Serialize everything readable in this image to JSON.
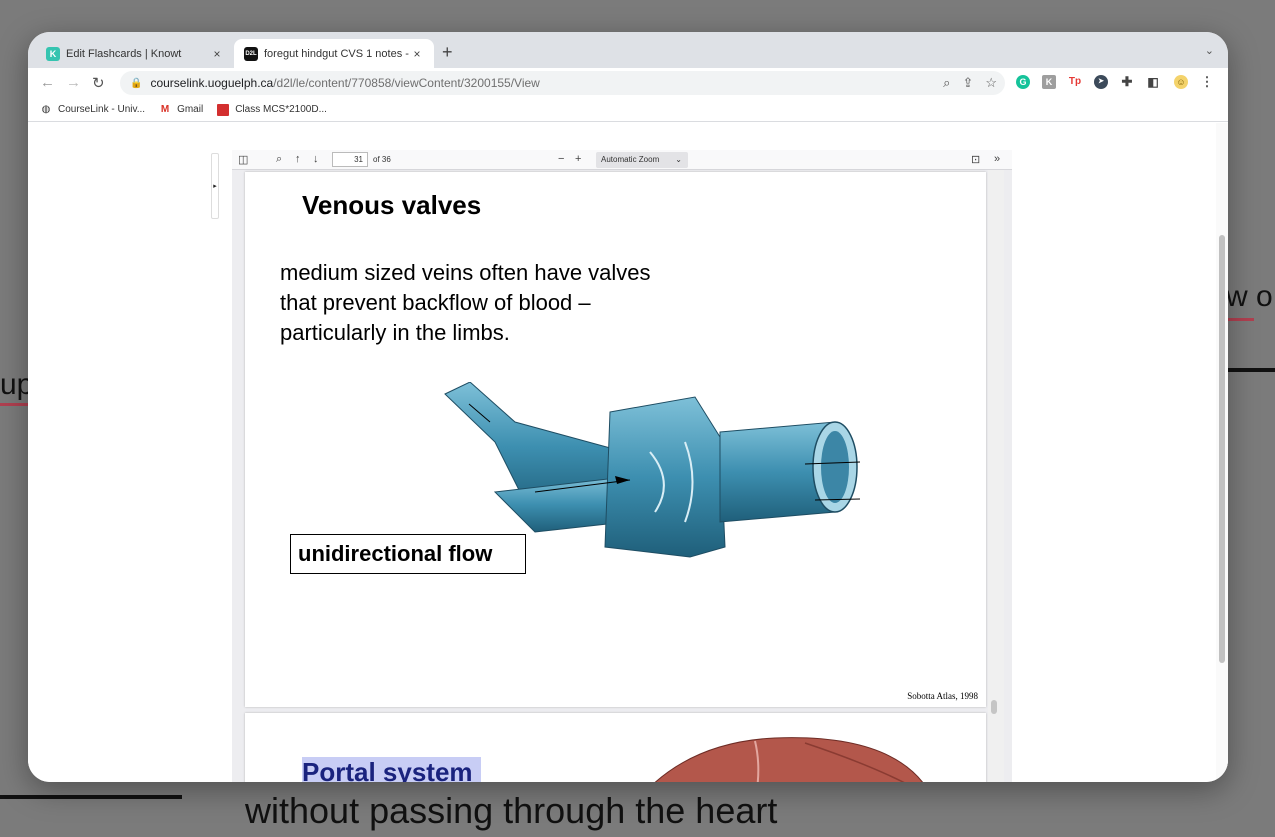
{
  "background": {
    "left_fragment": "up",
    "right_fragment": "w o",
    "bottom_line": "without passing through the heart"
  },
  "browser": {
    "tabs": [
      {
        "favicon": "K",
        "title": "Edit Flashcards | Knowt",
        "close": "×"
      },
      {
        "favicon": "D2L",
        "title": "foregut hindgut CVS 1 notes - ",
        "close": "×"
      }
    ],
    "new_tab": "+",
    "tab_menu": "⌄",
    "url_host": "courselink.uoguelph.ca",
    "url_path": "/d2l/le/content/770858/viewContent/3200155/View",
    "extensions": [
      {
        "name": "grammarly",
        "label": "G",
        "color": "#15c39a"
      },
      {
        "name": "knowt",
        "label": "K",
        "color": "#9e9e9e"
      },
      {
        "name": "tp",
        "label": "Tp",
        "color": "#e53935"
      },
      {
        "name": "cursor",
        "label": "➤",
        "color": "#3c4a5a"
      }
    ],
    "bookmarks": [
      {
        "icon": "globe-icon",
        "label": "CourseLink - Univ..."
      },
      {
        "icon": "gmail-icon",
        "label": "Gmail"
      },
      {
        "icon": "class-icon",
        "label": "Class MCS*2100D..."
      }
    ]
  },
  "pdf": {
    "page_number": "31",
    "page_of": "of 36",
    "zoom": "Automatic Zoom",
    "page1": {
      "title": "Venous valves",
      "body": "medium sized veins often have valves that prevent backflow of blood – particularly in the limbs.",
      "label_box": "unidirectional flow",
      "citation": "Sobotta Atlas, 1998"
    },
    "page2": {
      "title": "Portal system"
    }
  },
  "colors": {
    "vein": "#4a9ab8",
    "vein_dark": "#2f6f8c",
    "liver": "#b3574b",
    "portal_highlight": "#c8cdf5"
  }
}
